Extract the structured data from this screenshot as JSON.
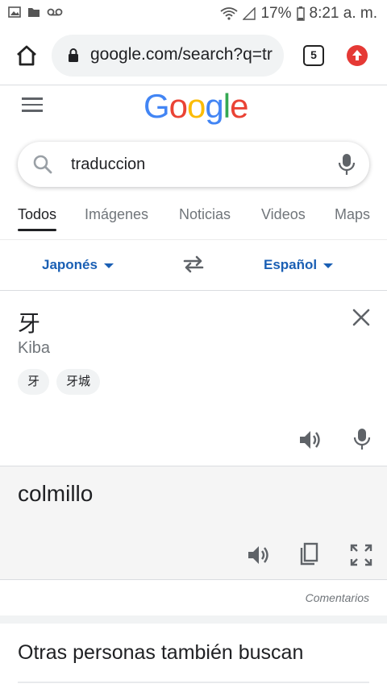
{
  "status_bar": {
    "battery": "17%",
    "time": "8:21 a. m."
  },
  "browser": {
    "url": "google.com/search?q=tr",
    "tab_count": "5"
  },
  "logo": {
    "letters": [
      "G",
      "o",
      "o",
      "g",
      "l",
      "e"
    ],
    "colors": [
      "#4285F4",
      "#EA4335",
      "#FBBC05",
      "#4285F4",
      "#34A853",
      "#EA4335"
    ]
  },
  "search": {
    "query": "traduccion"
  },
  "tabs": [
    "Todos",
    "Imágenes",
    "Noticias",
    "Videos",
    "Maps"
  ],
  "translate": {
    "source_lang": "Japonés",
    "target_lang": "Español",
    "source_text": "牙",
    "transliteration": "Kiba",
    "suggestions": [
      "牙",
      "牙城"
    ],
    "target_text": "colmillo",
    "feedback": "Comentarios"
  },
  "related": {
    "heading": "Otras personas también buscan"
  },
  "colors": {
    "accent_blue": "#1a5fb4",
    "update_red": "#e53935"
  }
}
